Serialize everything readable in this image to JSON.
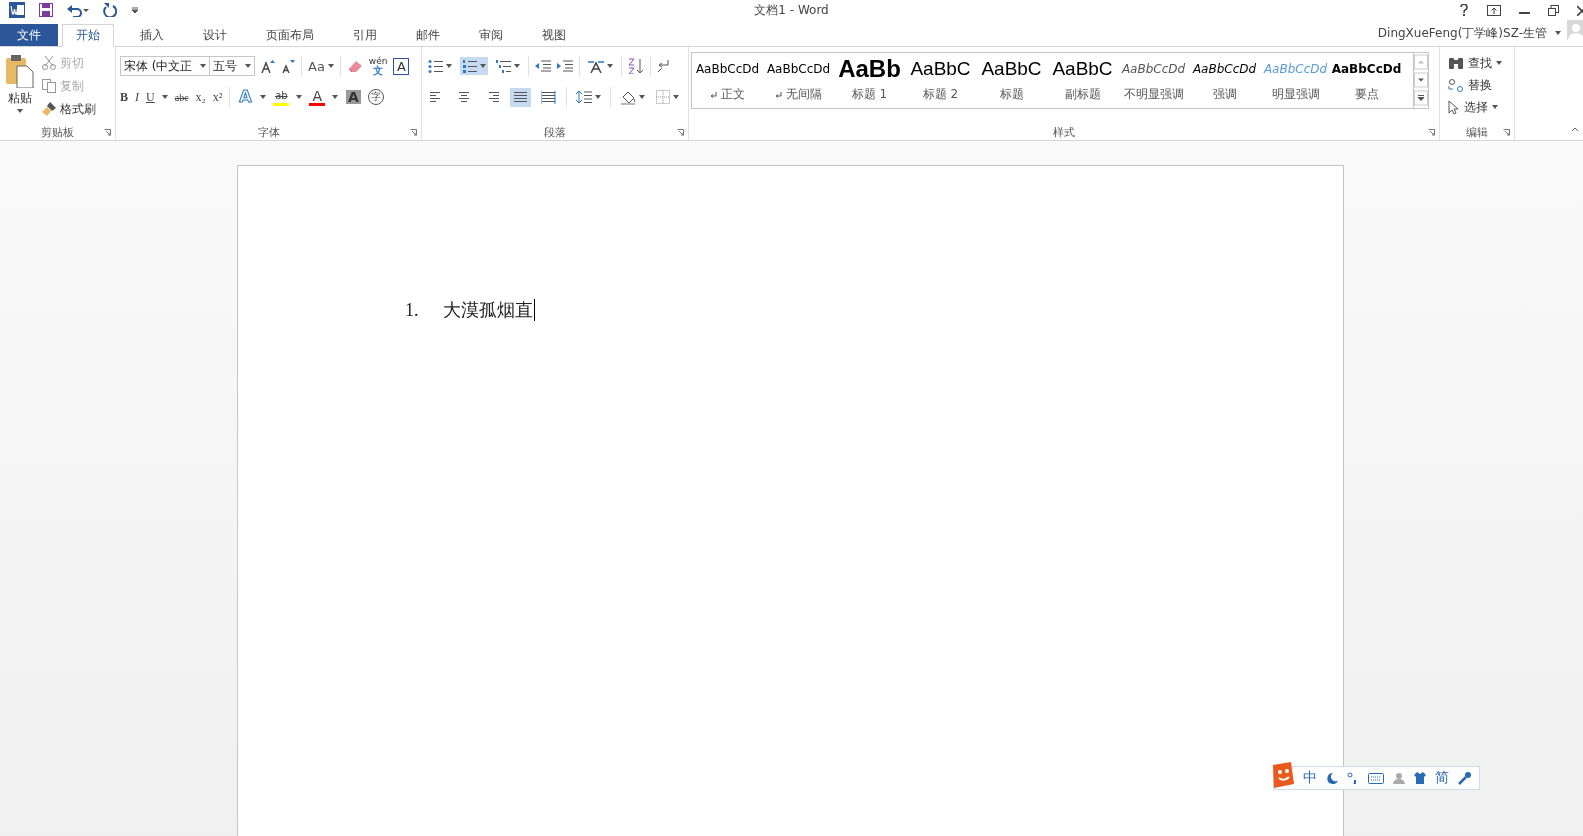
{
  "window": {
    "title": "文档1 - Word"
  },
  "tabs": [
    {
      "label": "文件",
      "kind": "file",
      "selected": false
    },
    {
      "label": "开始",
      "kind": "tab",
      "selected": true
    },
    {
      "label": "插入",
      "kind": "tab",
      "selected": false
    },
    {
      "label": "设计",
      "kind": "tab",
      "selected": false
    },
    {
      "label": "页面布局",
      "kind": "tab",
      "selected": false
    },
    {
      "label": "引用",
      "kind": "tab",
      "selected": false
    },
    {
      "label": "邮件",
      "kind": "tab",
      "selected": false
    },
    {
      "label": "审阅",
      "kind": "tab",
      "selected": false
    },
    {
      "label": "视图",
      "kind": "tab",
      "selected": false
    }
  ],
  "account": {
    "name": "DingXueFeng(丁学峰)SZ-生管"
  },
  "clipboard": {
    "paste": "粘贴",
    "cut": "剪切",
    "copy": "复制",
    "format_painter": "格式刷",
    "label": "剪贴板"
  },
  "font": {
    "font_name": "宋体 (中文正",
    "font_size": "五号",
    "change_case": "Aa",
    "phonetic": "wén",
    "phonetic_char": "文",
    "border_char": "A",
    "format_buttons": [
      {
        "glyph": "B",
        "kind": "bold"
      },
      {
        "glyph": "I",
        "kind": "italic"
      },
      {
        "glyph": "U",
        "kind": "underline"
      },
      {
        "glyph": "abc",
        "kind": "strike"
      },
      {
        "glyph": "x₂",
        "kind": "sub"
      },
      {
        "glyph": "x²",
        "kind": "sup"
      }
    ],
    "effect_buttons": [
      {
        "glyph": "A",
        "kind": "effects"
      },
      {
        "glyph": "ab",
        "kind": "highlight",
        "color": "#ffff00"
      },
      {
        "glyph": "A",
        "kind": "fontcolor",
        "color": "#ff0000"
      },
      {
        "glyph": "A",
        "kind": "shade"
      },
      {
        "glyph": "字",
        "kind": "circle"
      }
    ],
    "label": "字体"
  },
  "paragraph": {
    "bullets": {
      "selected": false
    },
    "numbering": {
      "selected": true
    },
    "alignment": [
      {
        "kind": "left",
        "selected": false
      },
      {
        "kind": "center",
        "selected": false
      },
      {
        "kind": "right",
        "selected": false
      },
      {
        "kind": "justify",
        "selected": true
      },
      {
        "kind": "distributed",
        "selected": false
      }
    ],
    "label": "段落"
  },
  "styles": {
    "items": [
      {
        "preview": "AaBbCcDd",
        "name": "正文",
        "kind": "normal",
        "marker": true
      },
      {
        "preview": "AaBbCcDd",
        "name": "无间隔",
        "kind": "normal",
        "marker": true
      },
      {
        "preview": "AaBb",
        "name": "标题 1",
        "kind": "h1",
        "marker": false
      },
      {
        "preview": "AaBbC",
        "name": "标题 2",
        "kind": "h2",
        "marker": false
      },
      {
        "preview": "AaBbC",
        "name": "标题",
        "kind": "h2",
        "marker": false
      },
      {
        "preview": "AaBbC",
        "name": "副标题",
        "kind": "h2",
        "marker": false
      },
      {
        "preview": "AaBbCcDd",
        "name": "不明显强调",
        "kind": "subtle",
        "marker": false
      },
      {
        "preview": "AaBbCcDd",
        "name": "强调",
        "kind": "emphasis",
        "marker": false
      },
      {
        "preview": "AaBbCcDd",
        "name": "明显强调",
        "kind": "intense",
        "marker": false
      },
      {
        "preview": "AaBbCcDd",
        "name": "要点",
        "kind": "strong",
        "marker": false
      }
    ],
    "label": "样式"
  },
  "editing": {
    "find": "查找",
    "replace": "替换",
    "select": "选择",
    "label": "编辑"
  },
  "document": {
    "list": [
      {
        "number": "1.",
        "text": "大漠孤烟直"
      }
    ]
  },
  "ime_bar": {
    "mode": "中",
    "script": "简"
  }
}
